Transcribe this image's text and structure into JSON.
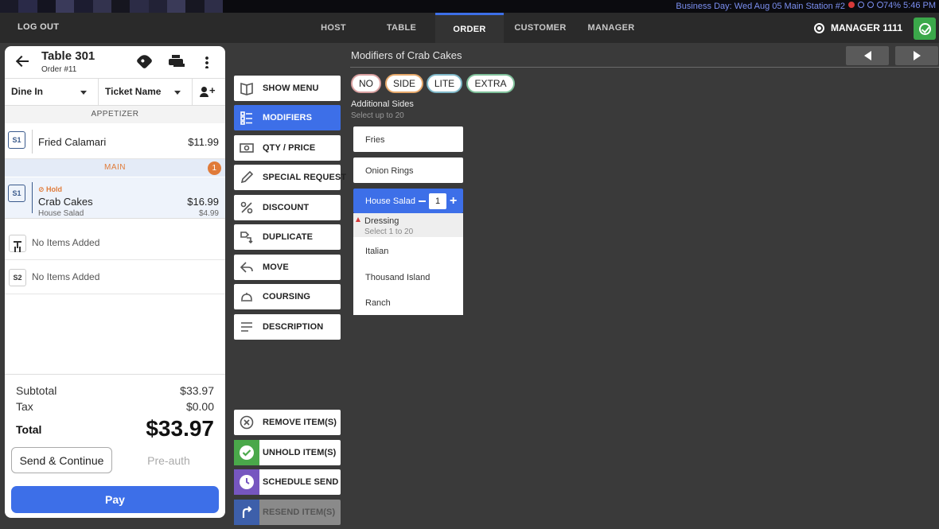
{
  "status_bar": {
    "info": "Business Day: Wed Aug 05  Main Station  #2",
    "battery": "74%",
    "time": "5:46 PM"
  },
  "topnav": {
    "logout": "LOG OUT",
    "tabs": [
      {
        "label": "HOST"
      },
      {
        "label": "TABLE"
      },
      {
        "label": "ORDER"
      },
      {
        "label": "CUSTOMER"
      },
      {
        "label": "MANAGER"
      }
    ],
    "active_tab": "ORDER",
    "user": "MANAGER 1111"
  },
  "ticket": {
    "table": "Table 301",
    "order": "Order #11",
    "service": "Dine In",
    "ticket_name": "Ticket Name",
    "categories": {
      "appetizer": "APPETIZER",
      "main": "MAIN",
      "main_badge": "1"
    },
    "items": {
      "fried": {
        "seat": "S1",
        "name": "Fried Calamari",
        "price": "$11.99"
      },
      "crab": {
        "seat": "S1",
        "hold": "Hold",
        "name": "Crab Cakes",
        "price": "$16.99",
        "sub": "House Salad",
        "sub_price": "$4.99"
      }
    },
    "empty_table": "No Items Added",
    "empty_s2": {
      "seat": "S2",
      "text": "No Items Added"
    },
    "totals": {
      "subtotal_label": "Subtotal",
      "subtotal": "$33.97",
      "tax_label": "Tax",
      "tax": "$0.00",
      "total_label": "Total",
      "total": "$33.97"
    },
    "send": "Send & Continue",
    "preauth": "Pre-auth",
    "pay": "Pay"
  },
  "actions": {
    "show_menu": "SHOW MENU",
    "modifiers": "MODIFIERS",
    "qty_price": "QTY / PRICE",
    "special_request": "SPECIAL REQUEST",
    "discount": "DISCOUNT",
    "duplicate": "DUPLICATE",
    "move": "MOVE",
    "coursing": "COURSING",
    "description": "DESCRIPTION",
    "remove": "REMOVE ITEM(S)",
    "unhold": "UNHOLD ITEM(S)",
    "schedule": "SCHEDULE SEND",
    "resend": "RESEND ITEM(S)"
  },
  "modifiers": {
    "title": "Modifiers of Crab Cakes",
    "pills": [
      "NO",
      "SIDE",
      "LITE",
      "EXTRA"
    ],
    "group": {
      "name": "Additional Sides",
      "rule": "Select up to 20"
    },
    "options": [
      "Fries",
      "Onion Rings"
    ],
    "selected": {
      "name": "House Salad",
      "qty": "1"
    },
    "sub_group": {
      "name": "Dressing",
      "rule": "Select 1 to 20",
      "options": [
        "Italian",
        "Thousand Island",
        "Ranch"
      ]
    }
  }
}
